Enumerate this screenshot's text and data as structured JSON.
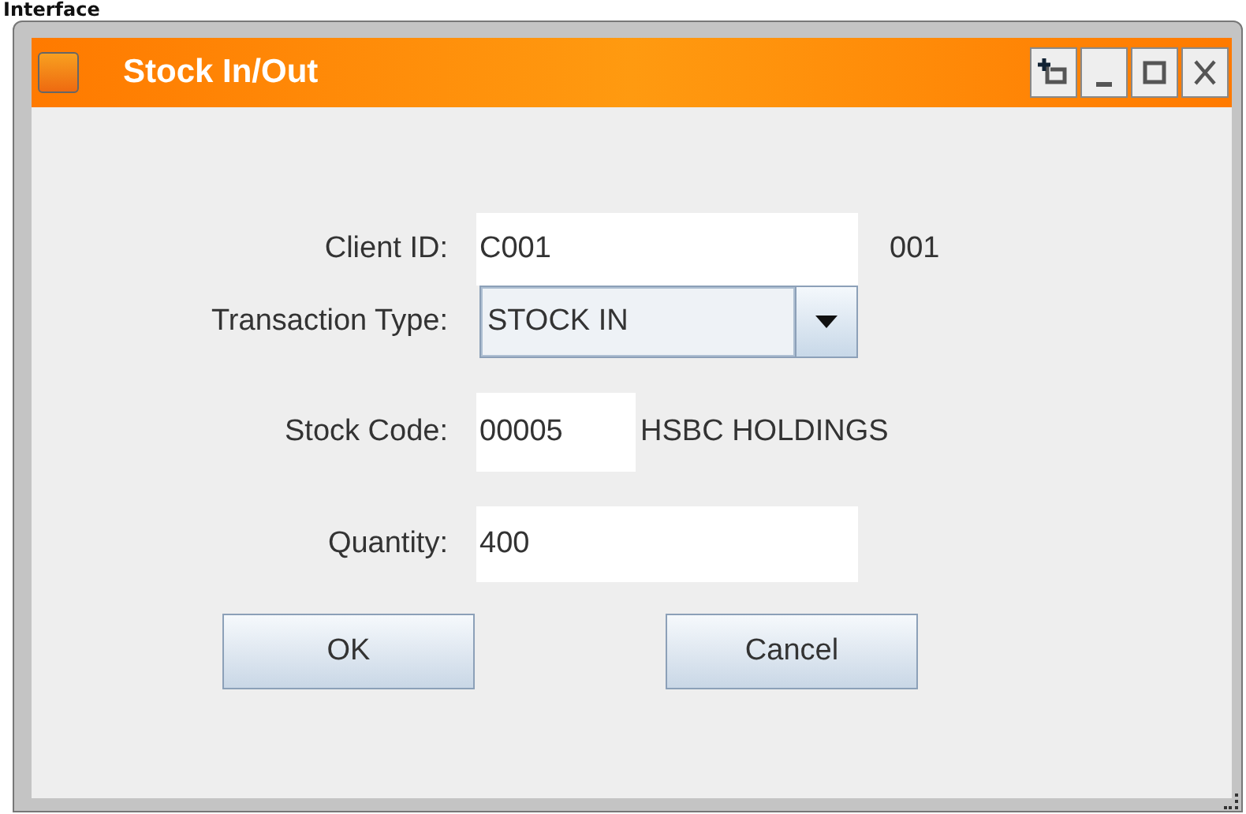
{
  "caption": "Interface",
  "window": {
    "title": "Stock In/Out",
    "controls": [
      {
        "kind": "pin"
      },
      {
        "kind": "minimize"
      },
      {
        "kind": "maximize"
      },
      {
        "kind": "close"
      }
    ]
  },
  "form": [
    {
      "kind": "text",
      "label": "Client ID:",
      "value": "C001",
      "note": "001"
    },
    {
      "kind": "select",
      "label": "Transaction Type:",
      "value": "STOCK IN"
    },
    {
      "kind": "short",
      "label": "Stock Code:",
      "value": "00005",
      "note": "HSBC HOLDINGS"
    },
    {
      "kind": "text",
      "label": "Quantity:",
      "value": "400"
    }
  ],
  "buttons": [
    "OK",
    "Cancel"
  ]
}
